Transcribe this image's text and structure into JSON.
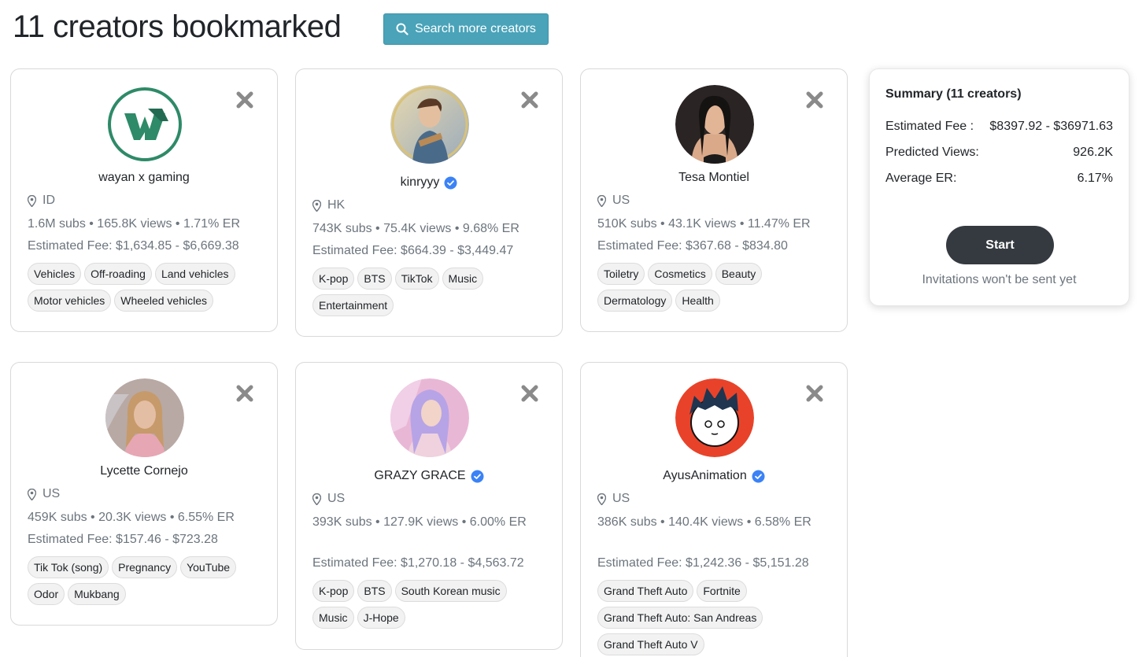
{
  "header": {
    "title": "11 creators bookmarked",
    "search_label": "Search more creators"
  },
  "colors": {
    "accent": "#4aa3b9",
    "dark_button": "#343a40",
    "verified": "#3b82f6",
    "muted_text": "#6c757d"
  },
  "creators": [
    {
      "name": "wayan x gaming",
      "verified": false,
      "location": "ID",
      "stats": "1.6M subs  •  165.8K views  •  1.71% ER",
      "fee": "Estimated Fee: $1,634.85 - $6,669.38",
      "tags": [
        "Vehicles",
        "Off-roading",
        "Land vehicles",
        "Motor vehicles",
        "Wheeled vehicles"
      ]
    },
    {
      "name": "kinryyy",
      "verified": true,
      "location": "HK",
      "stats": "743K subs  •  75.4K views  •  9.68% ER",
      "fee": "Estimated Fee: $664.39 - $3,449.47",
      "tags": [
        "K-pop",
        "BTS",
        "TikTok",
        "Music",
        "Entertainment"
      ]
    },
    {
      "name": "Tesa Montiel",
      "verified": false,
      "location": "US",
      "stats": "510K subs  •  43.1K views  •  11.47% ER",
      "fee": "Estimated Fee: $367.68 - $834.80",
      "tags": [
        "Toiletry",
        "Cosmetics",
        "Beauty",
        "Dermatology",
        "Health"
      ]
    },
    {
      "name": "Lycette Cornejo",
      "verified": false,
      "location": "US",
      "stats": "459K subs  •  20.3K views  •  6.55% ER",
      "fee": "Estimated Fee: $157.46 - $723.28",
      "tags": [
        "Tik Tok (song)",
        "Pregnancy",
        "YouTube",
        "Odor",
        "Mukbang"
      ]
    },
    {
      "name": "GRAZY GRACE",
      "verified": true,
      "location": "US",
      "stats": "393K subs  •  127.9K views  •  6.00% ER",
      "fee": "Estimated Fee: $1,270.18 - $4,563.72",
      "tags": [
        "K-pop",
        "BTS",
        "South Korean music",
        "Music",
        "J-Hope"
      ]
    },
    {
      "name": "AyusAnimation",
      "verified": true,
      "location": "US",
      "stats": "386K subs  •  140.4K views  •  6.58% ER",
      "fee": "Estimated Fee: $1,242.36 - $5,151.28",
      "tags": [
        "Grand Theft Auto",
        "Fortnite",
        "Grand Theft Auto: San Andreas",
        "Grand Theft Auto V"
      ]
    }
  ],
  "summary": {
    "title": "Summary (11 creators)",
    "fee_label": "Estimated Fee :",
    "fee_value": "$8397.92 - $36971.63",
    "views_label": "Predicted Views:",
    "views_value": "926.2K",
    "er_label": "Average ER:",
    "er_value": "6.17%",
    "start_label": "Start",
    "note": "Invitations won't be sent yet"
  }
}
